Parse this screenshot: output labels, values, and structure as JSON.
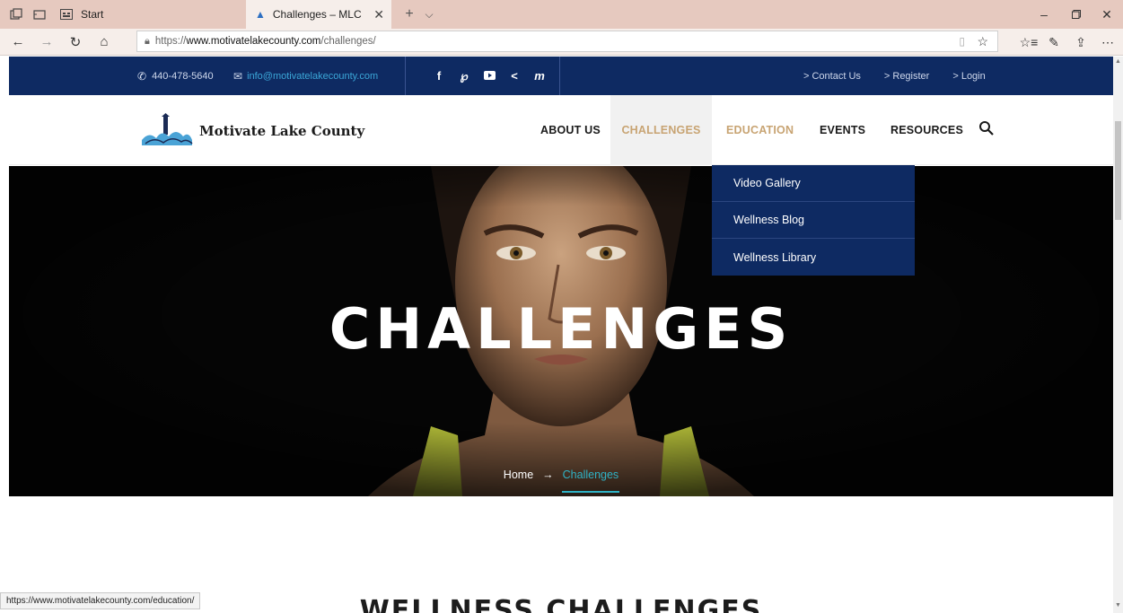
{
  "browser": {
    "tabs": [
      {
        "label": "Start",
        "icon": "start-page-icon"
      },
      {
        "label": "Challenges – MLC",
        "icon": "site-favicon",
        "active": true
      }
    ],
    "address": {
      "prefix": "https://",
      "host": "www.motivatelakecounty.com",
      "path": "/challenges/"
    },
    "status_url": "https://www.motivatelakecounty.com/education/"
  },
  "topbar": {
    "phone": "440-478-5640",
    "email": "info@motivatelakecounty.com",
    "links": [
      "> Contact Us",
      "> Register",
      "> Login"
    ]
  },
  "logo": {
    "text": "Motivate Lake County"
  },
  "nav": {
    "items": [
      "ABOUT US",
      "CHALLENGES",
      "EDUCATION",
      "EVENTS",
      "RESOURCES"
    ],
    "active_index": 1,
    "hover_index": 2
  },
  "dropdown": {
    "items": [
      "Video Gallery",
      "Wellness Blog",
      "Wellness Library"
    ]
  },
  "hero": {
    "title": "CHALLENGES",
    "breadcrumb_home": "Home",
    "breadcrumb_arrow": "→",
    "breadcrumb_current": "Challenges"
  },
  "section": {
    "title": "WELLNESS CHALLENGES"
  },
  "colors": {
    "navy": "#0e2a62",
    "gold": "#c8a473",
    "teal": "#2fb2c5",
    "email_link": "#3ba7d8"
  }
}
